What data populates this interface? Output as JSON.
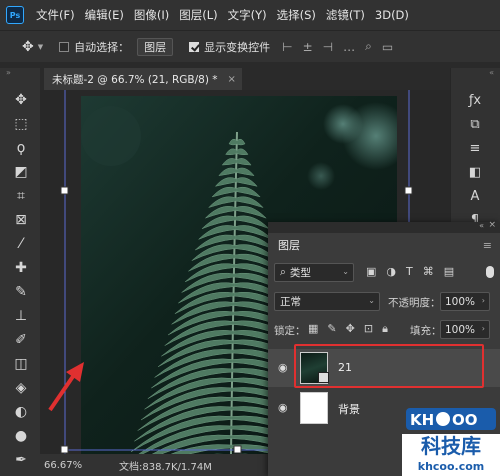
{
  "app": {
    "logo": "Ps"
  },
  "menu": [
    "文件(F)",
    "编辑(E)",
    "图像(I)",
    "图层(L)",
    "文字(Y)",
    "选择(S)",
    "滤镜(T)",
    "3D(D)"
  ],
  "options": {
    "auto_select_label": "自动选择：",
    "auto_select_checked": false,
    "target_value": "图层",
    "show_transform_label": "显示变换控件",
    "show_transform_checked": true
  },
  "document_tab": {
    "title": "未标题-2 @ 66.7% (21, RGB/8) *",
    "close": "×"
  },
  "status": {
    "zoom": "66.67%",
    "doc_info": "文档:838.7K/1.74M",
    "arrow": "›"
  },
  "layers_panel": {
    "tab_label": "图层",
    "filter_kind": "类型",
    "blend_mode": "正常",
    "opacity_label": "不透明度：",
    "opacity_value": "100%",
    "lock_label": "锁定：",
    "fill_label": "填充：",
    "fill_value": "100%",
    "layers": [
      {
        "name": "21",
        "selected": true
      },
      {
        "name": "背景",
        "selected": false
      }
    ]
  },
  "watermark": {
    "brand": "KHCOO",
    "cn": "科技库",
    "url": "khcoo.com"
  },
  "colors": {
    "highlight_border": "#e03030",
    "annotation_arrow": "#e03030",
    "panel_bg": "#3b3b3b",
    "app_bg": "#323232"
  }
}
